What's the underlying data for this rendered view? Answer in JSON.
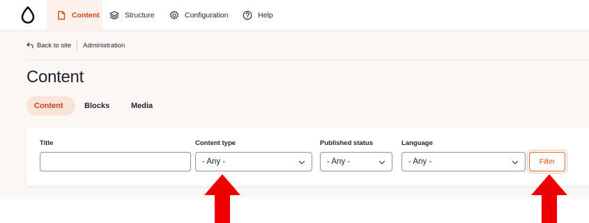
{
  "toolbar": {
    "items": [
      {
        "label": "Content",
        "icon": "file-icon",
        "active": true
      },
      {
        "label": "Structure",
        "icon": "layers-icon",
        "active": false
      },
      {
        "label": "Configuration",
        "icon": "gear-icon",
        "active": false
      },
      {
        "label": "Help",
        "icon": "help-icon",
        "active": false
      }
    ]
  },
  "breadcrumb": {
    "back_label": "Back to site",
    "current": "Administration"
  },
  "page": {
    "title": "Content"
  },
  "tabs": [
    {
      "label": "Content",
      "active": true
    },
    {
      "label": "Blocks",
      "active": false
    },
    {
      "label": "Media",
      "active": false
    }
  ],
  "filters": {
    "title_label": "Title",
    "title_value": "",
    "content_type_label": "Content type",
    "content_type_value": "- Any -",
    "published_status_label": "Published status",
    "published_status_value": "- Any -",
    "language_label": "Language",
    "language_value": "- Any -",
    "filter_button": "Filter"
  },
  "colors": {
    "accent": "#d3440b",
    "active_bg": "#fbe3d8",
    "page_bg": "#faf7f5",
    "annotation_arrow": "#ee0000"
  }
}
